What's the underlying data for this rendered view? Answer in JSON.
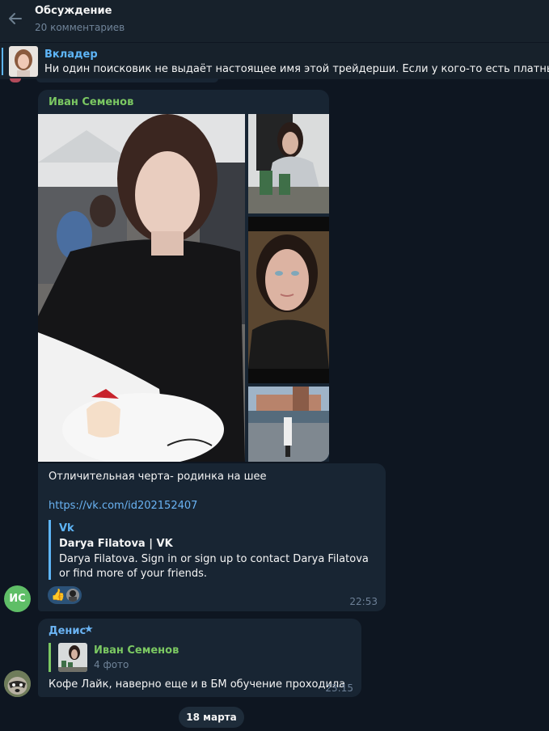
{
  "header": {
    "title": "Обсуждение",
    "subtitle": "20 комментариев"
  },
  "pinned": {
    "name": "Вкладер",
    "text": "Ни один поисковик не выдаёт настоящее имя этой трейдерши. Если у кого-то есть платный аккаунт,"
  },
  "album": {
    "sender": "Иван Семенов",
    "photo_count": 4
  },
  "message": {
    "text": "Отличительная черта- родинка на шее",
    "link": "https://vk.com/id202152407",
    "preview": {
      "site": "Vk",
      "title": "Darya Filatova | VK",
      "description": "Darya Filatova. Sign in or sign up to contact Darya Filatova or find more of your friends."
    },
    "reaction_emoji": "👍",
    "time": "22:53",
    "avatar_initials": "ИС"
  },
  "reply": {
    "sender": "Денис",
    "star_icon": "★",
    "quote_name": "Иван Семенов",
    "quote_sub": "4 фото",
    "text": "Кофе Лайк, наверно еще и в БМ обучение проходила",
    "time": "23:15"
  },
  "date_chip": "18 марта",
  "colors": {
    "background": "#0e1621",
    "bubble": "#182533",
    "accent_blue": "#5eb5f7",
    "accent_green": "#7bc862",
    "meta_gray": "#708499"
  }
}
